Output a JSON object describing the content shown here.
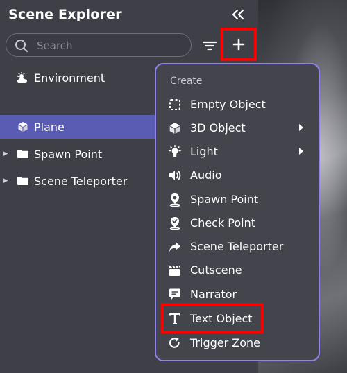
{
  "panel": {
    "title": "Scene Explorer",
    "collapse_icon": "double-chevron-left-icon",
    "search": {
      "placeholder": "Search",
      "value": ""
    },
    "filter_icon": "filter-icon",
    "add_icon": "plus-icon"
  },
  "tree": {
    "items": [
      {
        "label": "Environment",
        "icon": "environment-icon",
        "selected": false,
        "expandable": false
      },
      {
        "label": "Plane",
        "icon": "cube-icon",
        "selected": true,
        "expandable": false
      },
      {
        "label": "Spawn Point",
        "icon": "folder-icon",
        "selected": false,
        "expandable": true
      },
      {
        "label": "Scene Teleporter",
        "icon": "folder-icon",
        "selected": false,
        "expandable": true
      }
    ]
  },
  "menu": {
    "header": "Create",
    "items": [
      {
        "label": "Empty Object",
        "icon": "dashed-square-icon",
        "submenu": false
      },
      {
        "label": "3D Object",
        "icon": "cube-icon",
        "submenu": true
      },
      {
        "label": "Light",
        "icon": "lightbulb-icon",
        "submenu": true
      },
      {
        "label": "Audio",
        "icon": "speaker-icon",
        "submenu": false
      },
      {
        "label": "Spawn Point",
        "icon": "location-pin-icon",
        "submenu": false
      },
      {
        "label": "Check Point",
        "icon": "check-pin-icon",
        "submenu": false
      },
      {
        "label": "Scene Teleporter",
        "icon": "share-arrow-icon",
        "submenu": false
      },
      {
        "label": "Cutscene",
        "icon": "clapperboard-icon",
        "submenu": false
      },
      {
        "label": "Narrator",
        "icon": "chat-bubble-icon",
        "submenu": false
      },
      {
        "label": "Text Object",
        "icon": "text-t-icon",
        "submenu": false
      },
      {
        "label": "Trigger Zone",
        "icon": "refresh-arrow-icon",
        "submenu": false
      }
    ]
  },
  "colors": {
    "selection": "#5a5cb4",
    "menu_border": "#8d86e8",
    "highlight": "#ff0000"
  }
}
